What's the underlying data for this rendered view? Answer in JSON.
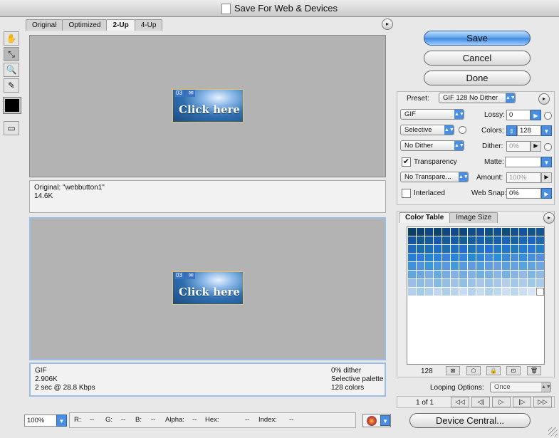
{
  "window": {
    "title": "Save For Web & Devices"
  },
  "tabs": [
    "Original",
    "Optimized",
    "2-Up",
    "4-Up"
  ],
  "active_tab": "2-Up",
  "tools": [
    "hand-icon",
    "slice-select-icon",
    "zoom-icon",
    "eyedropper-icon"
  ],
  "preview_button": {
    "text": "Click here",
    "badge": "03"
  },
  "original_info": {
    "line1": "Original: \"webbutton1\"",
    "line2": "14.6K"
  },
  "optimized_info": {
    "left1": "GIF",
    "left2": "2.906K",
    "left3": "2 sec @ 28.8 Kbps",
    "right1": "0% dither",
    "right2": "Selective palette",
    "right3": "128 colors"
  },
  "buttons": {
    "save": "Save",
    "cancel": "Cancel",
    "done": "Done",
    "device_central": "Device Central..."
  },
  "preset": {
    "label": "Preset:",
    "value": "GIF 128 No Dither"
  },
  "settings": {
    "format": "GIF",
    "reduction": "Selective",
    "dither_algo": "No Dither",
    "transparency_label": "Transparency",
    "transparency_checked": true,
    "transparency_dither": "No Transpare...",
    "interlaced_label": "Interlaced",
    "interlaced_checked": false,
    "lossy_label": "Lossy:",
    "lossy": "0",
    "colors_label": "Colors:",
    "colors": "128",
    "dither_label": "Dither:",
    "dither": "0%",
    "matte_label": "Matte:",
    "matte": "",
    "amount_label": "Amount:",
    "amount": "100%",
    "websnap_label": "Web Snap:",
    "websnap": "0%"
  },
  "panel_tabs": [
    "Color Table",
    "Image Size"
  ],
  "color_table": {
    "count": "128"
  },
  "looping": {
    "label": "Looping Options:",
    "value": "Once"
  },
  "frames": {
    "label": "1 of 1"
  },
  "zoom": "100%",
  "readouts": {
    "r_label": "R:",
    "r": "--",
    "g_label": "G:",
    "g": "--",
    "b_label": "B:",
    "b": "--",
    "alpha_label": "Alpha:",
    "alpha": "--",
    "hex_label": "Hex:",
    "hex": "--",
    "index_label": "Index:",
    "index": "--"
  }
}
